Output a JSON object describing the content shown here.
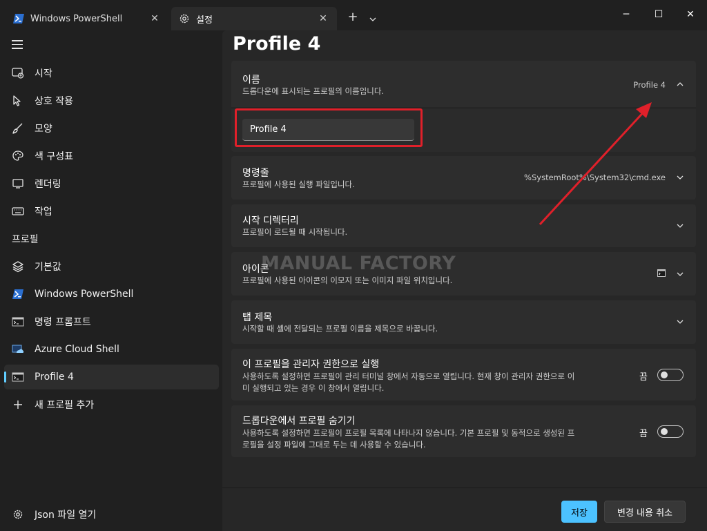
{
  "window": {
    "tabs": [
      {
        "label": "Windows PowerShell",
        "icon": "powershell-icon"
      },
      {
        "label": "설정",
        "icon": "gear-icon"
      }
    ],
    "new_tab": "+",
    "minimize": "─",
    "maximize": "☐",
    "close": "✕"
  },
  "sidebar": {
    "items": [
      {
        "label": "시작",
        "icon": "startup-icon"
      },
      {
        "label": "상호 작용",
        "icon": "interaction-icon"
      },
      {
        "label": "모양",
        "icon": "brush-icon"
      },
      {
        "label": "색 구성표",
        "icon": "palette-icon"
      },
      {
        "label": "렌더링",
        "icon": "monitor-icon"
      },
      {
        "label": "작업",
        "icon": "keyboard-icon"
      }
    ],
    "profiles_header": "프로필",
    "profiles": [
      {
        "label": "기본값",
        "icon": "layers-icon"
      },
      {
        "label": "Windows PowerShell",
        "icon": "powershell-icon"
      },
      {
        "label": "명령 프롬프트",
        "icon": "cmd-icon"
      },
      {
        "label": "Azure Cloud Shell",
        "icon": "azure-icon"
      },
      {
        "label": "Profile 4",
        "icon": "cmd-icon",
        "selected": true
      },
      {
        "label": "새 프로필 추가",
        "icon": "plus-icon"
      }
    ],
    "open_json": "Json 파일 열기"
  },
  "main": {
    "title": "Profile 4",
    "name_setting": {
      "title": "이름",
      "desc": "드롭다운에 표시되는 프로필의 이름입니다.",
      "value": "Profile 4",
      "input_value": "Profile 4"
    },
    "commandline": {
      "title": "명령줄",
      "desc": "프로필에 사용된 실행 파일입니다.",
      "value": "%SystemRoot%\\System32\\cmd.exe"
    },
    "start_dir": {
      "title": "시작 디렉터리",
      "desc": "프로필이 로드될 때 시작됩니다."
    },
    "icon_setting": {
      "title": "아이콘",
      "desc": "프로필에 사용된 아이콘의 이모지 또는 이미지 파일 위치입니다."
    },
    "tab_title": {
      "title": "탭 제목",
      "desc": "시작할 때 셸에 전달되는 프로필 이름을 제목으로 바꿉니다."
    },
    "run_as_admin": {
      "title": "이 프로필을 관리자 권한으로 실행",
      "desc_line1": "사용하도록 설정하면 프로필이 관리 터미널 창에서 자동으로 열립니다. 현재 창이 관리자 권한으로 이",
      "desc_line2": "미 실행되고 있는 경우 이 창에서 열립니다.",
      "state": "끔"
    },
    "hide_dropdown": {
      "title": "드롭다운에서 프로필 숨기기",
      "desc_line1": "사용하도록 설정하면 프로필이 프로필 목록에 나타나지 않습니다. 기본 프로필 및 동적으로 생성된 프",
      "desc_line2": "로필을 설정 파일에 그대로 두는 데 사용할 수 있습니다.",
      "state": "끔"
    }
  },
  "watermark": "MANUAL FACTORY",
  "footer": {
    "save": "저장",
    "discard": "변경 내용 취소"
  },
  "colors": {
    "accent": "#4cc2ff",
    "annotation": "#e0202a"
  }
}
